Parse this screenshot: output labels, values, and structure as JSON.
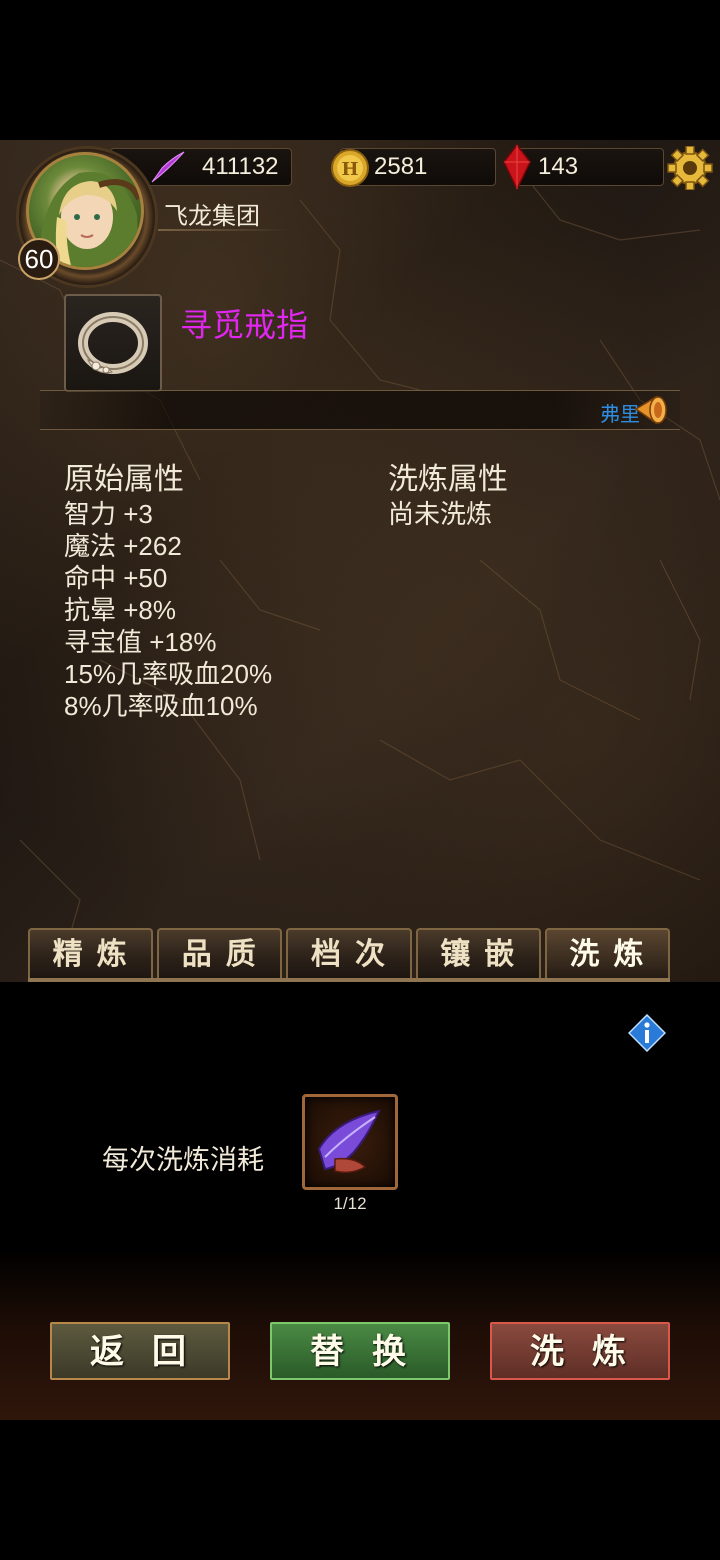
{
  "colors": {
    "item_name": "#e126f0",
    "strip_text": "#2e8de0",
    "button_swap": "#4a8a44",
    "button_wash": "#8a4a3e",
    "button_back": "#5d5a3f"
  },
  "header": {
    "power_icon": "purple-feather-icon",
    "power": "411132",
    "gold_icon": "gold-coin-icon",
    "gold": "2581",
    "gem_icon": "red-crystal-icon",
    "gems": "143",
    "settings_icon": "gear-icon"
  },
  "player": {
    "level": "60",
    "guild": "飞龙集团"
  },
  "item": {
    "icon": "ring-icon",
    "name": "寻觅戒指"
  },
  "broadcast": {
    "text": "弗里",
    "icon": "horn-icon"
  },
  "original_attrs": {
    "title": "原始属性",
    "lines": [
      "智力 +3",
      "魔法 +262",
      "命中 +50",
      "抗晕 +8%",
      "寻宝值 +18%",
      "15%几率吸血20%",
      "8%几率吸血10%"
    ]
  },
  "washed_attrs": {
    "title": "洗炼属性",
    "status": "尚未洗炼"
  },
  "tabs": [
    {
      "label": "精炼"
    },
    {
      "label": "品质"
    },
    {
      "label": "档次"
    },
    {
      "label": "镶嵌"
    },
    {
      "label": "洗炼",
      "active": true
    }
  ],
  "cost": {
    "label": "每次洗炼消耗",
    "material_icon": "purple-feather-material-icon",
    "count": "1/12"
  },
  "info_icon": "info-icon",
  "buttons": {
    "back": "返回",
    "swap": "替换",
    "wash": "洗炼"
  }
}
